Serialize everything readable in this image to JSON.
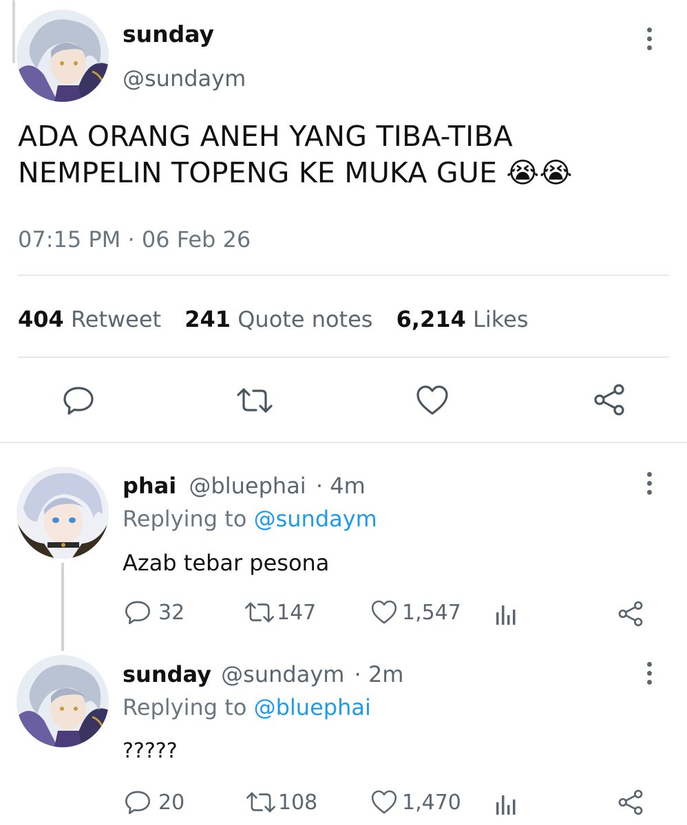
{
  "tweet": {
    "author_name": "sunday",
    "author_handle": "@sundaym",
    "text_line1": "ADA ORANG ANEH YANG TIBA-TIBA",
    "text_line2": "NEMPELIN TOPENG KE MUKA GUE",
    "emoji": "😭😭",
    "timestamp": "07:15 PM · 06 Feb 26",
    "stats": {
      "retweet_count": "404",
      "retweet_label": "Retweet",
      "quote_count": "241",
      "quote_label": "Quote notes",
      "likes_count": "6,214",
      "likes_label": "Likes"
    }
  },
  "replies": [
    {
      "name": "phai",
      "handle": "@bluephai",
      "time": "· 4m",
      "replying_prefix": "Replying to",
      "replying_to": "@sundaym",
      "text": "Azab tebar pesona",
      "replies": "32",
      "retweets": "147",
      "likes": "1,547"
    },
    {
      "name": "sunday",
      "handle": "@sundaym",
      "time": "· 2m",
      "replying_prefix": "Replying to",
      "replying_to": "@bluephai",
      "text": "?????",
      "replies": "20",
      "retweets": "108",
      "likes": "1,470"
    }
  ],
  "colors": {
    "link": "#1d9bf0",
    "muted": "#5b6670",
    "divider": "#e6e9ec"
  }
}
